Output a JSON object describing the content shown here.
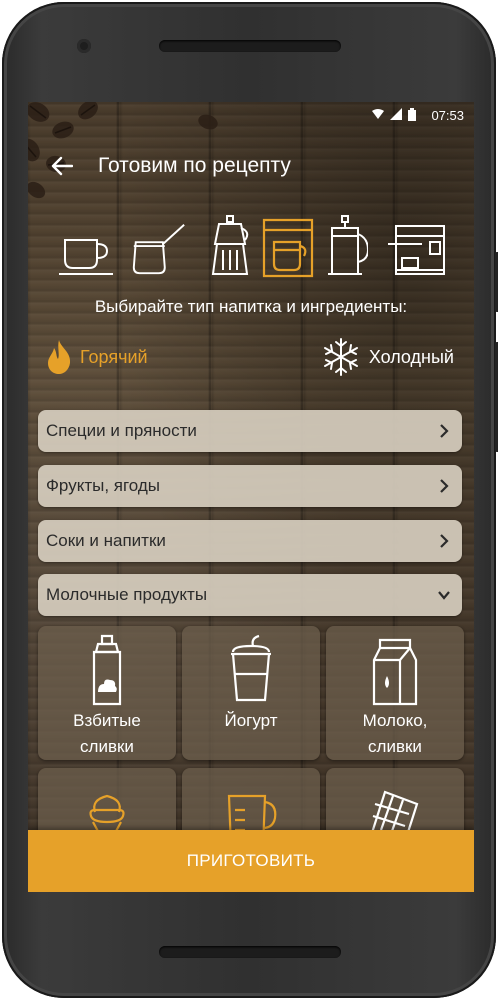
{
  "status_bar": {
    "time": "07:53"
  },
  "app_bar": {
    "title": "Готовим по рецепту"
  },
  "brew_methods": [
    {
      "icon": "cup-icon",
      "selected": false
    },
    {
      "icon": "turkish-cezve-icon",
      "selected": false
    },
    {
      "icon": "moka-pot-icon",
      "selected": false
    },
    {
      "icon": "drip-coffee-maker-icon",
      "selected": true
    },
    {
      "icon": "french-press-icon",
      "selected": false
    },
    {
      "icon": "espresso-machine-icon",
      "selected": false
    }
  ],
  "hint": "Выбирайте тип напитка и ингредиенты:",
  "temperature": {
    "hot": {
      "label": "Горячий",
      "icon": "flame-icon",
      "selected": true
    },
    "cold": {
      "label": "Холодный",
      "icon": "snowflake-icon",
      "selected": false
    }
  },
  "categories": [
    {
      "label": "Специи и пряности",
      "expanded": false
    },
    {
      "label": "Фрукты, ягоды",
      "expanded": false
    },
    {
      "label": "Соки и напитки",
      "expanded": false
    },
    {
      "label": "Молочные продукты",
      "expanded": true
    }
  ],
  "dairy_items": [
    {
      "line1": "Взбитые",
      "line2": "сливки",
      "icon": "whipped-cream-can-icon"
    },
    {
      "line1": "Йогурт",
      "line2": "",
      "icon": "yogurt-cup-icon"
    },
    {
      "line1": "Молоко,",
      "line2": "сливки",
      "icon": "milk-carton-icon"
    },
    {
      "line1": "",
      "line2": "",
      "icon": "ice-cream-icon"
    },
    {
      "line1": "",
      "line2": "",
      "icon": "measuring-jug-icon"
    },
    {
      "line1": "",
      "line2": "",
      "icon": "chocolate-bar-icon"
    }
  ],
  "action": {
    "label": "ПРИГОТОВИТЬ"
  },
  "colors": {
    "accent": "#e6a129",
    "text": "#ffffff",
    "panel": "#d6cdbe"
  }
}
